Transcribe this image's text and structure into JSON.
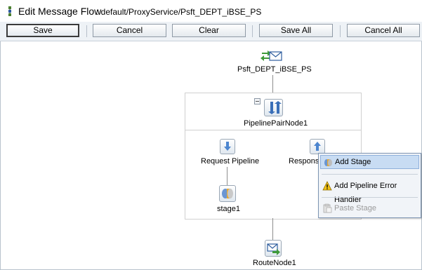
{
  "title": {
    "main": "Edit Message Flow",
    "path": ": default/ProxyService/Psft_DEPT_iBSE_PS"
  },
  "toolbar": {
    "save": "Save",
    "cancel": "Cancel",
    "clear": "Clear",
    "save_all": "Save All",
    "cancel_all": "Cancel All"
  },
  "flow": {
    "proxy_service": "Psft_DEPT_iBSE_PS",
    "pipeline_pair": "PipelinePairNode1",
    "request_pipeline": "Request Pipeline",
    "response_pipeline": "Response",
    "stage": "stage1",
    "route_node": "RouteNode1"
  },
  "context_menu": {
    "items": [
      {
        "label": "Add Stage",
        "icon": "add-stage-icon",
        "state": "highlighted"
      },
      {
        "label": "Add Pipeline Error Handler",
        "icon": "warning-icon",
        "state": "enabled"
      },
      {
        "label": "Paste Stage",
        "icon": "paste-icon",
        "state": "disabled"
      }
    ]
  }
}
